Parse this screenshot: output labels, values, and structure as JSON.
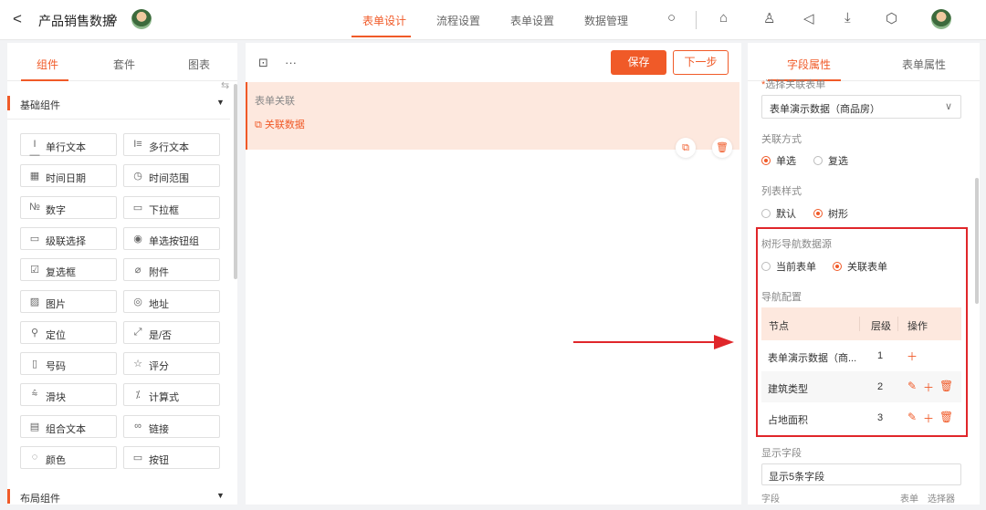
{
  "header": {
    "back_icon": "back-arrow-icon",
    "title": "产品销售数据",
    "tabs": [
      {
        "label": "表单设计",
        "active": true
      },
      {
        "label": "流程设置",
        "active": false
      },
      {
        "label": "表单设置",
        "active": false
      },
      {
        "label": "数据管理",
        "active": false
      }
    ]
  },
  "left": {
    "tabs": [
      {
        "label": "组件",
        "active": true
      },
      {
        "label": "套件",
        "active": false
      },
      {
        "label": "图表",
        "active": false
      }
    ],
    "section_basic": "基础组件",
    "section_layout": "布局组件",
    "components": [
      {
        "label": "单行文本",
        "glyph": "I—"
      },
      {
        "label": "多行文本",
        "glyph": "I≡"
      },
      {
        "label": "时间日期",
        "glyph": "▦"
      },
      {
        "label": "时间范围",
        "glyph": "◷"
      },
      {
        "label": "数字",
        "glyph": "№"
      },
      {
        "label": "下拉框",
        "glyph": "▭"
      },
      {
        "label": "级联选择",
        "glyph": "▭"
      },
      {
        "label": "单选按钮组",
        "glyph": "◉"
      },
      {
        "label": "复选框",
        "glyph": "☑"
      },
      {
        "label": "附件",
        "glyph": "⌀"
      },
      {
        "label": "图片",
        "glyph": "▨"
      },
      {
        "label": "地址",
        "glyph": "◎"
      },
      {
        "label": "定位",
        "glyph": "⚲"
      },
      {
        "label": "是/否",
        "glyph": "⤢"
      },
      {
        "label": "号码",
        "glyph": "▯"
      },
      {
        "label": "评分",
        "glyph": "☆"
      },
      {
        "label": "滑块",
        "glyph": "⩯"
      },
      {
        "label": "计算式",
        "glyph": "⁒"
      },
      {
        "label": "组合文本",
        "glyph": "▤"
      },
      {
        "label": "链接",
        "glyph": "∞"
      },
      {
        "label": "颜色",
        "glyph": "◌"
      },
      {
        "label": "按钮",
        "glyph": "▭"
      }
    ]
  },
  "middle": {
    "save_label": "保存",
    "next_label": "下一步",
    "field_label": "表单关联",
    "field_link": "关联数据"
  },
  "right": {
    "tabs": [
      {
        "label": "字段属性",
        "active": true
      },
      {
        "label": "表单属性",
        "active": false
      }
    ],
    "select_form_label": "选择关联表单",
    "select_form_value": "表单演示数据（商品房）",
    "relation_label": "关联方式",
    "relation_options": [
      {
        "label": "单选",
        "selected": true
      },
      {
        "label": "复选",
        "selected": false
      }
    ],
    "list_style_label": "列表样式",
    "list_style_options": [
      {
        "label": "默认",
        "selected": false
      },
      {
        "label": "树形",
        "selected": true
      }
    ],
    "tree_source_label": "树形导航数据源",
    "tree_source_options": [
      {
        "label": "当前表单",
        "selected": false
      },
      {
        "label": "关联表单",
        "selected": true
      }
    ],
    "nav_config_label": "导航配置",
    "table_headers": {
      "node": "节点",
      "level": "层级",
      "action": "操作"
    },
    "rows": [
      {
        "node": "表单演示数据（商...",
        "level": "1"
      },
      {
        "node": "建筑类型",
        "level": "2"
      },
      {
        "node": "占地面积",
        "level": "3"
      }
    ],
    "display_field_label": "显示字段",
    "display_field_value": "显示5条字段",
    "footer": {
      "field": "字段",
      "form": "表单",
      "selector": "选择器"
    }
  },
  "colors": {
    "accent": "#f05a28",
    "highlight_box": "#e0262a",
    "card_bg": "#fde8de"
  }
}
